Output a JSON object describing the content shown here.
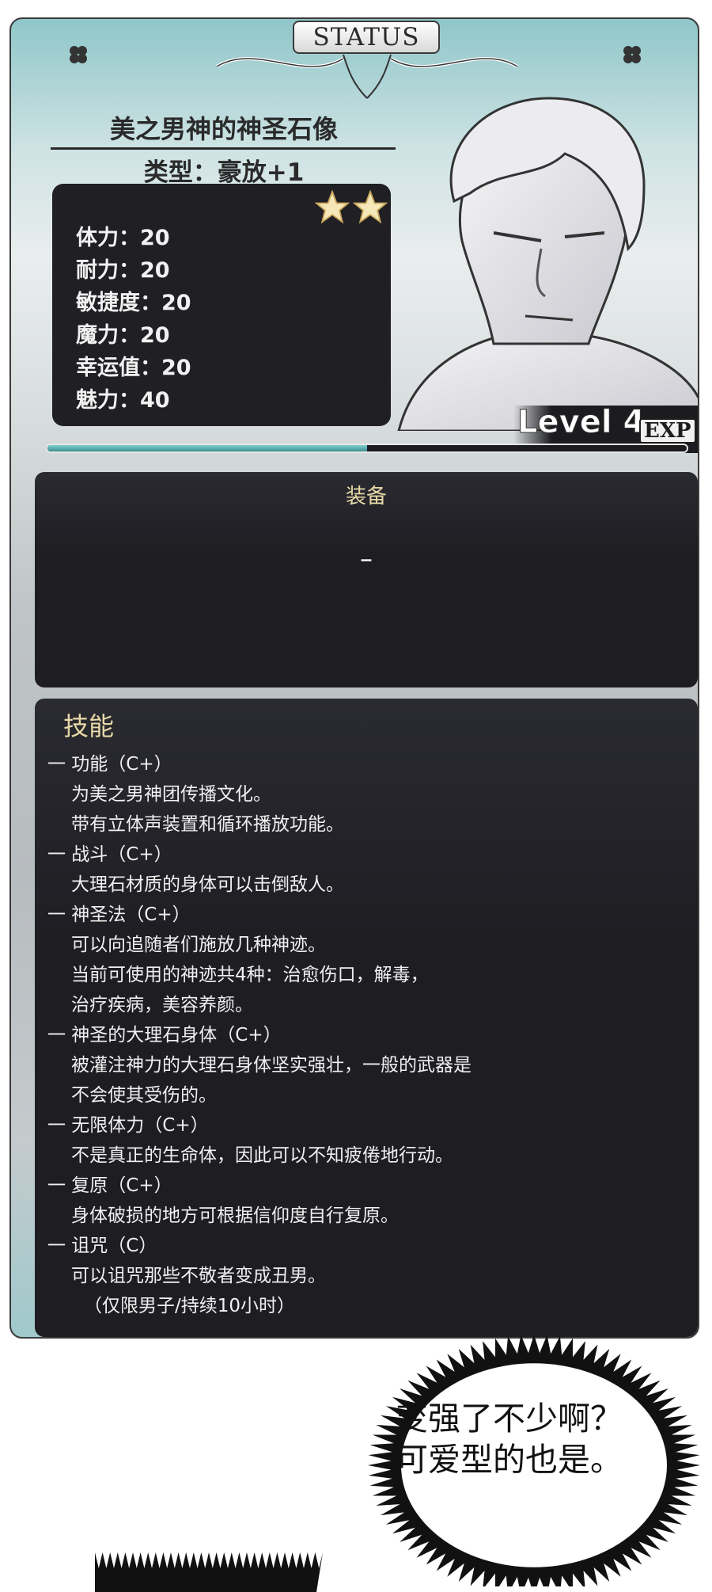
{
  "header": {
    "tab_label": "STATUS"
  },
  "character": {
    "name": "美之男神的神圣石像",
    "type": "类型：豪放+1",
    "stars": 2
  },
  "stats": [
    {
      "label": "体力：20"
    },
    {
      "label": "耐力：20"
    },
    {
      "label": "敏捷度：20"
    },
    {
      "label": "魔力：20"
    },
    {
      "label": "幸运值：20"
    },
    {
      "label": "魅力：40"
    }
  ],
  "level": {
    "text": "Level 4",
    "exp_label": "EXP",
    "exp_fraction": 0.5
  },
  "equipment": {
    "title": "装备",
    "value": "–"
  },
  "skills": {
    "title": "技能",
    "lines": [
      {
        "text": "一 功能（C+）",
        "kind": "head"
      },
      {
        "text": "为美之男神团传播文化。",
        "kind": "indent"
      },
      {
        "text": "带有立体声装置和循环播放功能。",
        "kind": "indent"
      },
      {
        "text": "一 战斗（C+）",
        "kind": "head"
      },
      {
        "text": "大理石材质的身体可以击倒敌人。",
        "kind": "indent"
      },
      {
        "text": "一 神圣法（C+）",
        "kind": "head"
      },
      {
        "text": "可以向追随者们施放几种神迹。",
        "kind": "indent"
      },
      {
        "text": "当前可使用的神迹共4种：治愈伤口，解毒，",
        "kind": "indent"
      },
      {
        "text": "治疗疾病，美容养颜。",
        "kind": "indent"
      },
      {
        "text": "一 神圣的大理石身体（C+）",
        "kind": "head"
      },
      {
        "text": "被灌注神力的大理石身体坚实强壮，一般的武器是",
        "kind": "indent"
      },
      {
        "text": "不会使其受伤的。",
        "kind": "indent"
      },
      {
        "text": "一 无限体力（C+）",
        "kind": "head"
      },
      {
        "text": "不是真正的生命体，因此可以不知疲倦地行动。",
        "kind": "indent"
      },
      {
        "text": "一 复原（C+）",
        "kind": "head"
      },
      {
        "text": "身体破损的地方可根据信仰度自行复原。",
        "kind": "indent"
      },
      {
        "text": "一 诅咒（C）",
        "kind": "head"
      },
      {
        "text": "可以诅咒那些不敬者变成丑男。",
        "kind": "indent"
      },
      {
        "text": "（仅限男子/持续10小时）",
        "kind": "extra"
      }
    ]
  },
  "speech_bubble": {
    "lines": [
      "变强了不少啊？",
      "可爱型的也是。"
    ]
  },
  "colors": {
    "panel_bg": "#1d1d22",
    "title_gold": "#e8d9a8",
    "exp_teal": "#5fb5b4"
  },
  "icons": [
    "clover-icon",
    "star-icon"
  ]
}
